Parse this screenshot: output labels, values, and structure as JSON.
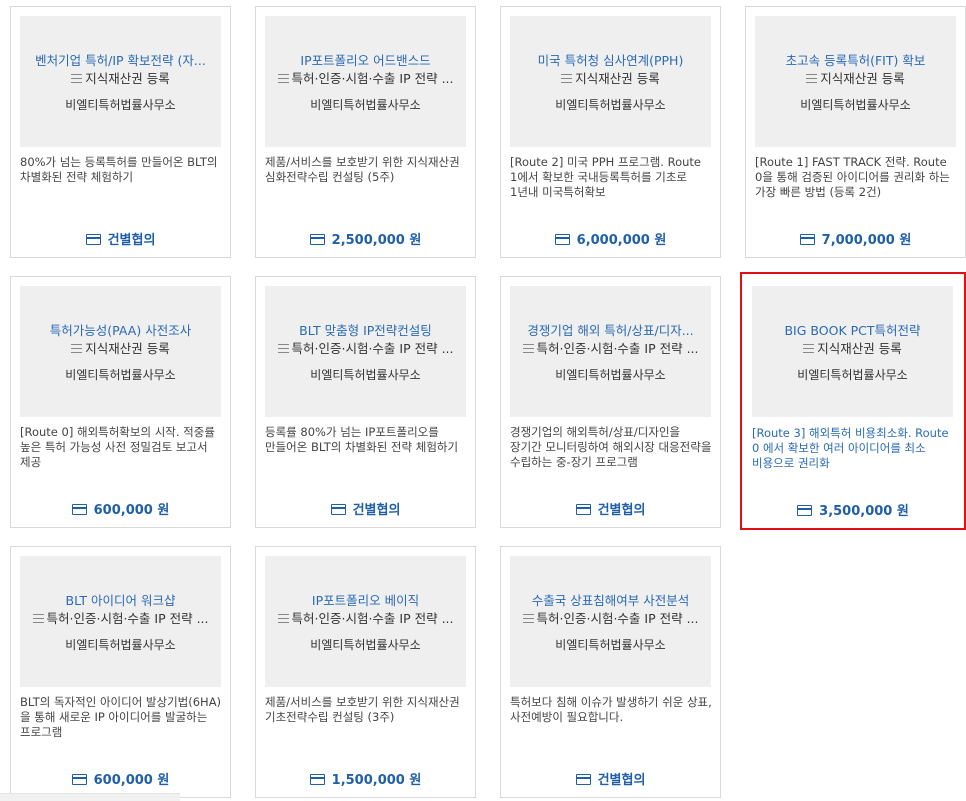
{
  "products": [
    {
      "title": "벤처기업 특허/IP 확보전략 (자...",
      "category": "지식재산권 등록",
      "firm": "비엘티특허법률사무소",
      "description": "80%가 넘는 등록특허를 만들어온 BLT의 차별화된 전략 체험하기",
      "price": "건별협의",
      "icon": "credit-card-icon",
      "selected": false
    },
    {
      "title": "IP포트폴리오 어드밴스드",
      "category": "특허·인증·시험·수출 IP 전략 ...",
      "firm": "비엘티특허법률사무소",
      "description": "제품/서비스를 보호받기 위한 지식재산권 심화전략수립 컨설팅 (5주)",
      "price": "2,500,000 원",
      "icon": "credit-card-icon",
      "selected": false
    },
    {
      "title": "미국 특허청 심사연계(PPH)",
      "category": "지식재산권 등록",
      "firm": "비엘티특허법률사무소",
      "description": "[Route 2] 미국 PPH 프로그램. Route 1에서 확보한 국내등록특허를 기초로 1년내 미국특허확보",
      "price": "6,000,000 원",
      "icon": "credit-card-icon",
      "selected": false
    },
    {
      "title": "초고속 등록특허(FIT) 확보",
      "category": "지식재산권 등록",
      "firm": "비엘티특허법률사무소",
      "description": "[Route 1] FAST TRACK 전략. Route 0을 통해 검증된 아이디어를 권리화 하는 가장 빠른 방법 (등록 2건)",
      "price": "7,000,000 원",
      "icon": "credit-card-icon",
      "selected": false
    },
    {
      "title": "특허가능성(PAA) 사전조사",
      "category": "지식재산권 등록",
      "firm": "비엘티특허법률사무소",
      "description": "[Route 0] 해외특허확보의 시작. 적중률 높은 특허 가능성 사전 정밀검토 보고서 제공",
      "price": "600,000 원",
      "icon": "credit-card-icon",
      "selected": false
    },
    {
      "title": "BLT 맞춤형 IP전략컨설팅",
      "category": "특허·인증·시험·수출 IP 전략 ...",
      "firm": "비엘티특허법률사무소",
      "description": "등록률 80%가 넘는 IP포트폴리오를 만들어온 BLT의 차별화된 전략 체험하기",
      "price": "건별협의",
      "icon": "credit-card-icon",
      "selected": false
    },
    {
      "title": "경쟁기업 해외 특허/상표/디자...",
      "category": "특허·인증·시험·수출 IP 전략 ...",
      "firm": "비엘티특허법률사무소",
      "description": "경쟁기업의 해외특허/상표/디자인을 장기간 모니터링하여 해외시장 대응전략을 수립하는 중-장기 프로그램",
      "price": "건별협의",
      "icon": "credit-card-icon",
      "selected": false
    },
    {
      "title": "BIG BOOK PCT특허전략",
      "category": "지식재산권 등록",
      "firm": "비엘티특허법률사무소",
      "description": "[Route 3] 해외특허 비용최소화. Route 0 에서 확보한 여러 아이디어를 최소 비용으로 권리화",
      "price": "3,500,000 원",
      "icon": "credit-card-icon",
      "selected": true
    },
    {
      "title": "BLT 아이디어 워크샵",
      "category": "특허·인증·시험·수출 IP 전략 ...",
      "firm": "비엘티특허법률사무소",
      "description": "BLT의 독자적인 아이디어 발상기법(6HA)을 통해 새로운 IP 아이디어를 발굴하는 프로그램",
      "price": "600,000 원",
      "icon": "credit-card-icon",
      "selected": false
    },
    {
      "title": "IP포트폴리오 베이직",
      "category": "특허·인증·시험·수출 IP 전략 ...",
      "firm": "비엘티특허법률사무소",
      "description": "제품/서비스를 보호받기 위한 지식재산권 기초전략수립 컨설팅 (3주)",
      "price": "1,500,000 원",
      "icon": "credit-card-icon",
      "selected": false
    },
    {
      "title": "수출국 상표침해여부 사전분석",
      "category": "특허·인증·시험·수출 IP 전략 ...",
      "firm": "비엘티특허법률사무소",
      "description": "특허보다 침해 이슈가 발생하기 쉬운 상표, 사전예방이 필요합니다.",
      "price": "건별협의",
      "icon": "credit-card-icon",
      "selected": false
    }
  ],
  "colors": {
    "accent": "#1f5fa8",
    "title": "#2a6ab4",
    "selected_border": "#e01010",
    "thumb_bg": "#efefef"
  }
}
